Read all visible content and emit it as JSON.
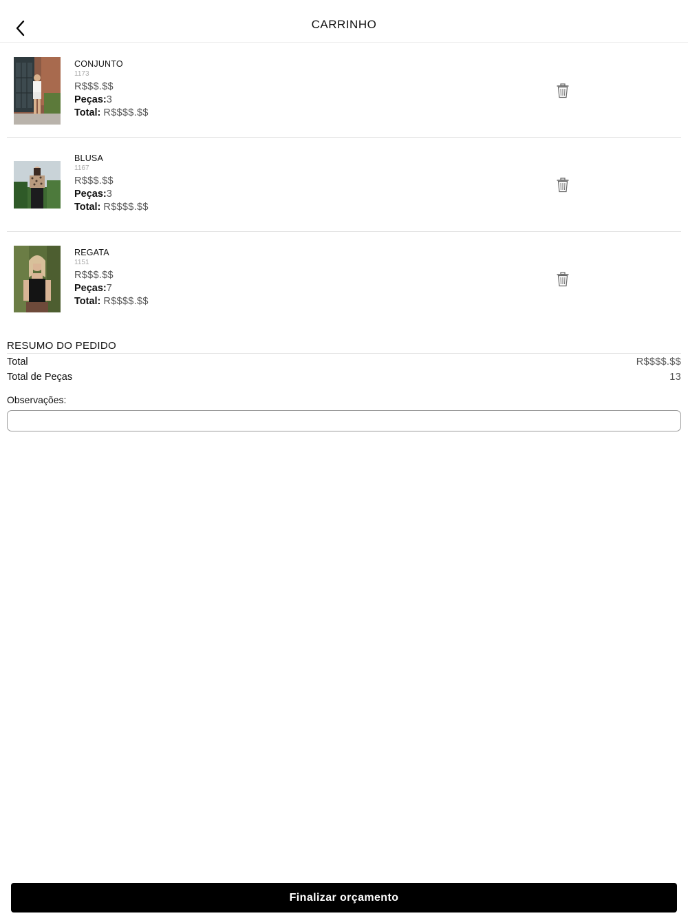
{
  "header": {
    "title": "CARRINHO",
    "back_icon": "chevron-left-icon"
  },
  "items": [
    {
      "name": "CONJUNTO",
      "code": "1173",
      "price": "R$$$.$$",
      "pieces_label": "Peças:",
      "pieces": "3",
      "total_label": "Total:",
      "total": "R$$$$.$$",
      "delete_icon": "trash-icon"
    },
    {
      "name": "BLUSA",
      "code": "1167",
      "price": "R$$$.$$",
      "pieces_label": "Peças:",
      "pieces": "3",
      "total_label": "Total:",
      "total": "R$$$$.$$",
      "delete_icon": "trash-icon"
    },
    {
      "name": "REGATA",
      "code": "1151",
      "price": "R$$$.$$",
      "pieces_label": "Peças:",
      "pieces": "7",
      "total_label": "Total:",
      "total": "R$$$$.$$",
      "delete_icon": "trash-icon"
    }
  ],
  "summary": {
    "title": "RESUMO DO PEDIDO",
    "total_label": "Total",
    "total_value": "R$$$$.$$",
    "pieces_label": "Total de Peças",
    "pieces_value": "13",
    "notes_label": "Observações:",
    "notes_value": "",
    "notes_placeholder": ""
  },
  "footer": {
    "button_label": "Finalizar orçamento"
  },
  "colors": {
    "button_bg": "#000000",
    "button_text": "#ffffff",
    "price_text": "#555555",
    "divider": "#e2e2e2"
  }
}
